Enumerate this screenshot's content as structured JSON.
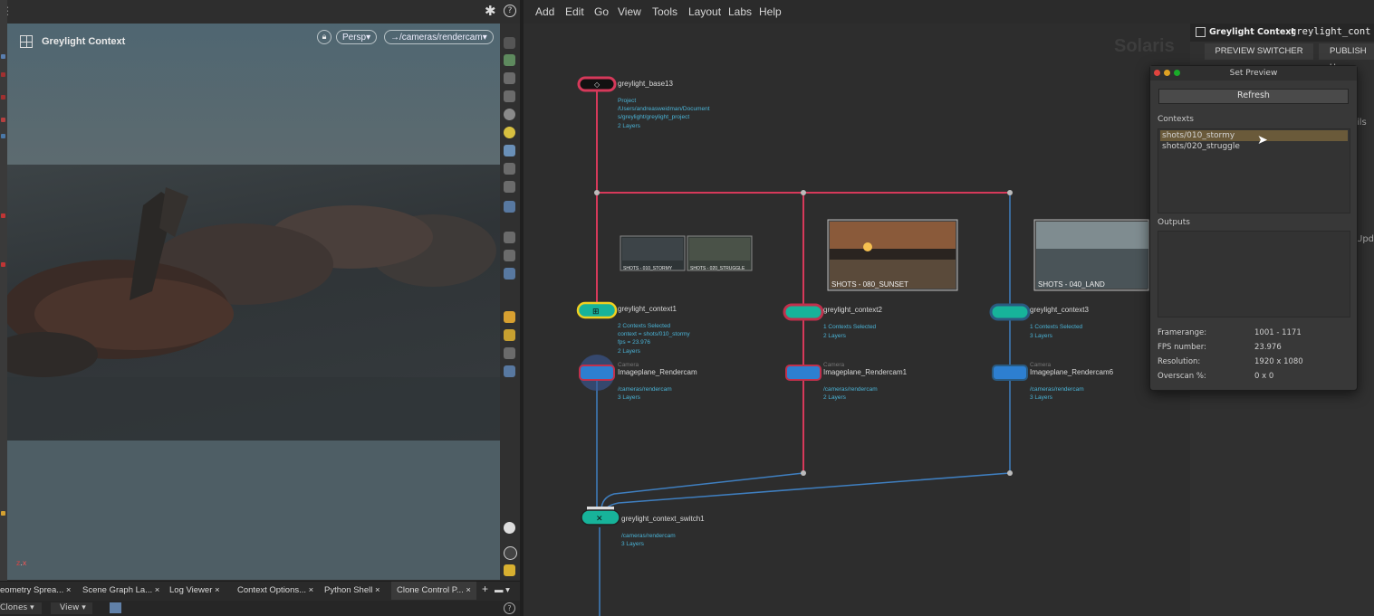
{
  "viewport": {
    "title": "Greylight Context",
    "camera_mode": "Persp",
    "camera_path": "→/cameras/rendercam"
  },
  "network_menu": [
    "Add",
    "Edit",
    "Go",
    "View",
    "Tools",
    "Layout",
    "Labs",
    "Help"
  ],
  "pane_tabs": [
    "eometry Sprea...",
    "Scene Graph La...",
    "Log Viewer",
    "Context Options...",
    "Python Shell",
    "Clone Control P..."
  ],
  "pane_bar": {
    "left_menu": "Clones",
    "view_menu": "View"
  },
  "right_pane": {
    "watermark": "Solaris",
    "header_title": "Greylight Context",
    "header_value": "greylight_cont",
    "buttons": [
      "PREVIEW SWITCHER",
      "PUBLISH H"
    ],
    "side_fragments": [
      "ils",
      "Upd"
    ]
  },
  "set_preview": {
    "title": "Set Preview",
    "refresh_label": "Refresh",
    "contexts_label": "Contexts",
    "contexts": [
      "shots/010_stormy",
      "shots/020_struggle"
    ],
    "selected_context": 0,
    "outputs_label": "Outputs",
    "props": [
      {
        "label": "Framerange:",
        "value": "1001 - 1171"
      },
      {
        "label": "FPS number:",
        "value": "23.976"
      },
      {
        "label": "Resolution:",
        "value": "1920 x 1080"
      },
      {
        "label": "Overscan %:",
        "value": "0 x 0"
      }
    ]
  },
  "nodes": {
    "base": {
      "name": "greylight_base13",
      "sub": [
        "Project",
        "/Users/andreasweidman/Document",
        "s/greylight/greylight_project",
        "2 Layers"
      ]
    },
    "context1": {
      "name": "greylight_context1",
      "sub": [
        "2 Contexts Selected",
        "context = shots/010_stormy",
        "fps = 23.976",
        "2 Layers"
      ]
    },
    "context2": {
      "name": "greylight_context2",
      "sub": [
        "1 Contexts Selected",
        "2 Layers"
      ]
    },
    "context3": {
      "name": "greylight_context3",
      "sub": [
        "1 Contexts Selected",
        "3 Layers"
      ]
    },
    "cam1": {
      "name": "Imageplane_Rendercam",
      "type": "Camera",
      "sub": [
        "/cameras/rendercam",
        "3 Layers"
      ]
    },
    "cam2": {
      "name": "Imageplane_Rendercam1",
      "type": "Camera",
      "sub": [
        "/cameras/rendercam",
        "2 Layers"
      ]
    },
    "cam3": {
      "name": "Imageplane_Rendercam6",
      "type": "Camera",
      "sub": [
        "/cameras/rendercam",
        "3 Layers"
      ]
    },
    "switch": {
      "name": "greylight_context_switch1",
      "sub": [
        "/cameras/rendercam",
        "3 Layers"
      ]
    }
  },
  "thumbnails": [
    {
      "caption": "SHOTS - 010_STORMY"
    },
    {
      "caption": "SHOTS - 020_STRUGGLE"
    },
    {
      "caption": "SHOTS - 080_SUNSET"
    },
    {
      "caption": "SHOTS - 040_LAND"
    }
  ],
  "colors": {
    "wire_red": "#d6395a",
    "wire_blue": "#3f7fc0",
    "node_teal": "#17b39a",
    "highlight": "#6a5a3a"
  }
}
